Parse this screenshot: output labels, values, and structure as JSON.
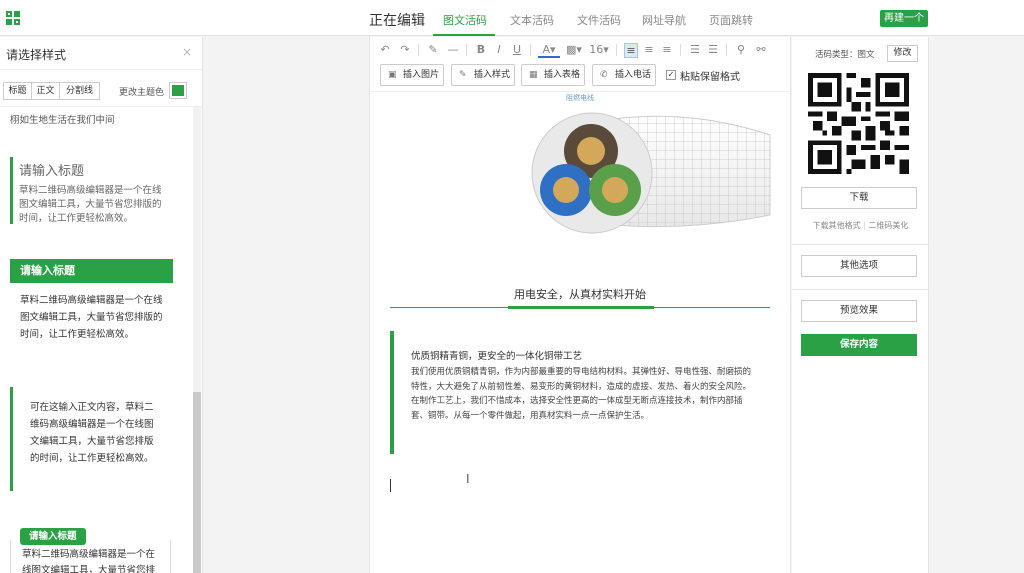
{
  "header": {
    "title": "正在编辑",
    "tabs": [
      {
        "label": "图文活码"
      },
      {
        "label": "文本活码"
      },
      {
        "label": "文件活码"
      },
      {
        "label": "网址导航"
      },
      {
        "label": "页面跳转"
      }
    ],
    "new_button": "再建一个"
  },
  "left_panel": {
    "title": "请选择样式",
    "close": "×",
    "segments": [
      "标题",
      "正文",
      "分割线"
    ],
    "theme_label": "更改主题色",
    "theme_color": "#2aa145",
    "snippet": "栩如生地生活在我们中间",
    "style1": {
      "title": "请输入标题",
      "body": "草料二维码高级编辑器是一个在线图文编辑工具，大量节省您排版的时间，让工作更轻松高效。"
    },
    "style2": {
      "title": "请输入标题",
      "body": "草料二维码高级编辑器是一个在线图文编辑工具，大量节省您排版的时间，让工作更轻松高效。"
    },
    "style3": {
      "body": "可在这输入正文内容，草料二维码高级编辑器是一个在线图文编辑工具，大量节省您排版的时间，让工作更轻松高效。"
    },
    "style4": {
      "title": "请输入标题",
      "body": "草料二维码高级编辑器是一个在线图文编辑工具，大量节省您排"
    }
  },
  "toolbar": {
    "font_size": "16",
    "buttons": [
      {
        "label": "插入图片"
      },
      {
        "label": "插入样式"
      },
      {
        "label": "插入表格"
      },
      {
        "label": "插入电话"
      }
    ],
    "paste_checkbox": "粘贴保留格式"
  },
  "content": {
    "image_caption": "阻燃电线",
    "banner": "用电安全，从真材实料开始",
    "article_title": "优质铜精青铜，更安全的一体化铜带工艺",
    "article_body": "我们使用优质铜精青铜，作为内部最重要的导电结构材料。其弹性好、导电性强、耐磨损的特性，大大避免了从前韧性差、易变形的黄铜材料，造成的虚接、发热、着火的安全风险。 在制作工艺上，我们不惜成本，选择安全性更高的一体成型无断点连接技术，制作内部插套、铜带。从每一个零件做起，用真材实料一点一点保护生活。"
  },
  "right_panel": {
    "type_label": "活码类型：图文",
    "edit_button": "修改",
    "download_button": "下载",
    "other_formats": "下载其他格式",
    "beautify": "二维码美化",
    "other_options": "其他选项",
    "preview": "预览效果",
    "save": "保存内容"
  }
}
